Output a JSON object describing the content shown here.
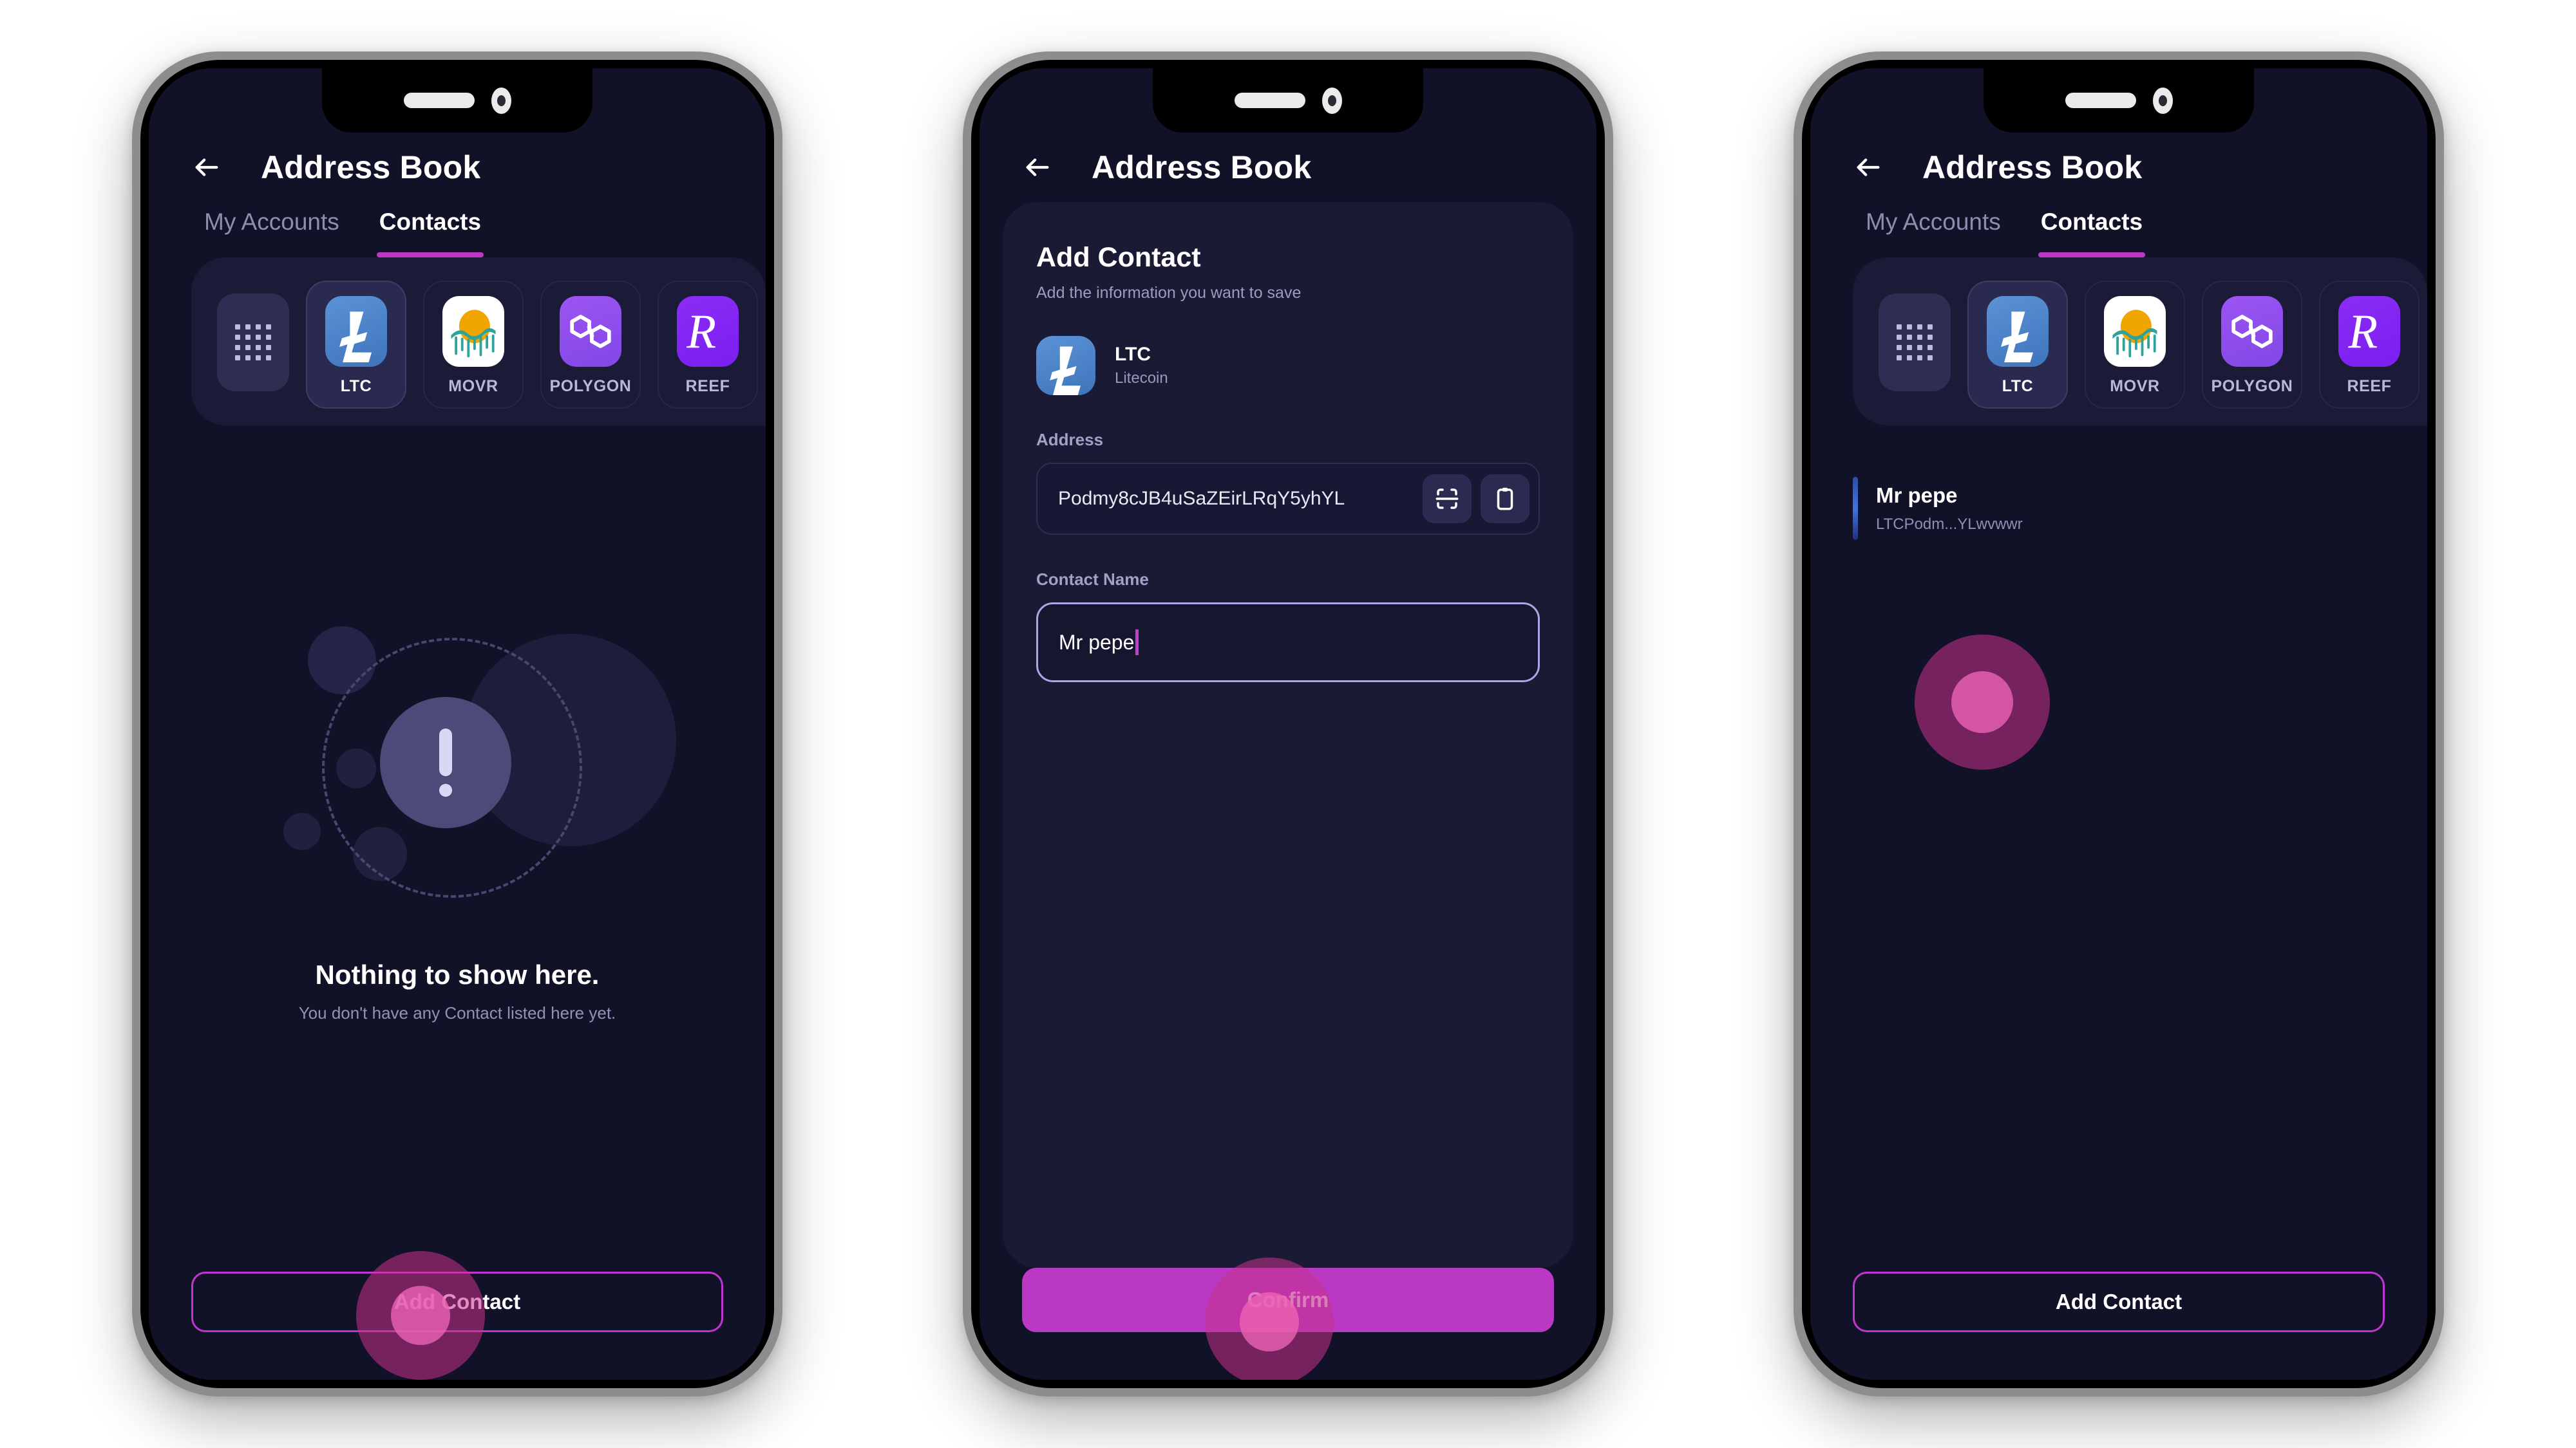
{
  "app": {
    "title": "Address Book",
    "back_icon": "arrow-left-icon"
  },
  "tabs": [
    {
      "label": "My Accounts",
      "active": false
    },
    {
      "label": "Contacts",
      "active": true
    }
  ],
  "chain_selector": {
    "grid_icon": "grid-dots-icon",
    "chains": [
      {
        "symbol": "LTC",
        "selected": true
      },
      {
        "symbol": "MOVR",
        "selected": false
      },
      {
        "symbol": "POLYGON",
        "selected": false
      },
      {
        "symbol": "REEF",
        "selected": false
      }
    ]
  },
  "empty_state": {
    "icon": "exclamation-circle-icon",
    "title": "Nothing to show here.",
    "subtitle": "You don't have any Contact listed here yet."
  },
  "buttons": {
    "add_contact": "Add Contact",
    "confirm": "Confirm"
  },
  "add_contact_form": {
    "title": "Add Contact",
    "subtitle": "Add the information you want to save",
    "coin": {
      "symbol": "LTC",
      "name": "Litecoin",
      "logo": "litecoin-logo"
    },
    "address_label": "Address",
    "address_value": "Podmy8cJB4uSaZEirLRqY5yhYL",
    "scan_icon": "qr-scan-icon",
    "paste_icon": "clipboard-paste-icon",
    "name_label": "Contact Name",
    "name_value": "Mr pepe"
  },
  "contacts": [
    {
      "name": "Mr pepe",
      "address": "LTCPodm...YLwvwwr"
    }
  ],
  "colors": {
    "accent": "#bd37c5",
    "screen_bg": "#111128",
    "card_bg": "#1a1a35",
    "touch_outer": "#8f3a74",
    "touch_inner": "#d45a9e",
    "ltc_blue": "#4f86cf",
    "polygon_purple": "#8247e5",
    "reef_purple": "#7b1ef0"
  }
}
